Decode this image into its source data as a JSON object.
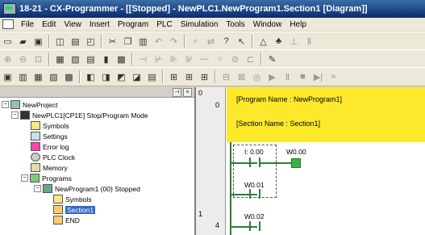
{
  "window": {
    "title": "18-21 - CX-Programmer - [[Stopped] - NewPLC1.NewProgram1.Section1 [Diagram]]"
  },
  "menu": [
    "File",
    "Edit",
    "View",
    "Insert",
    "Program",
    "PLC",
    "Simulation",
    "Tools",
    "Window",
    "Help"
  ],
  "toolbars": {
    "row1": [
      "new-icon",
      "open-icon",
      "save-icon",
      "print-preview-icon",
      "print-icon",
      "preview-icon",
      "cut-icon",
      "copy-icon",
      "paste-icon",
      "undo-icon",
      "redo-icon",
      "find-icon",
      "replace-icon",
      "help-icon",
      "context-help-icon",
      "zoom-icon",
      "monitor-icon",
      "online-icon",
      "clock-icon"
    ],
    "row2": [
      "zoom-in-icon",
      "zoom-out-icon",
      "zoom-fit-icon",
      "grid-icon",
      "layout-icon",
      "table-icon",
      "bookmark-icon",
      "properties-icon",
      "contact-no-icon",
      "contact-nc-icon",
      "or-no-icon",
      "or-nc-icon",
      "line-icon",
      "coil-icon",
      "coil-nc-icon",
      "instruction-icon",
      "online-edit-icon"
    ],
    "row3": [
      "project-icon",
      "section-icon",
      "symbols-icon",
      "window-icon",
      "io-table-icon",
      "monitor-icon",
      "watch-icon",
      "memory-icon",
      "transfer-icon",
      "ladder-icon",
      "bits-16-icon",
      "bits-32-icon",
      "bits-64-icon",
      "compile-icon",
      "check-icon",
      "simulate-icon",
      "run-icon",
      "pause-icon",
      "stop-icon",
      "step-icon",
      "step-into-icon"
    ]
  },
  "tree": {
    "project": "NewProject",
    "plc": "NewPLC1[CP1E] Stop/Program Mode",
    "plc_items": [
      "Symbols",
      "Settings",
      "Error log",
      "PLC Clock",
      "Memory"
    ],
    "programs": "Programs",
    "program": "NewProgram1 (00) Stopped",
    "program_items": [
      "Symbols",
      "Section1",
      "END"
    ]
  },
  "diagram": {
    "program_name": "[Program Name : NewProgram1]",
    "section_name": "[Section Name : Section1]",
    "rung0": {
      "number": "0",
      "step": "0",
      "contact1": "I: 0.00",
      "contact2": "W0.00",
      "coil": "W0.01"
    },
    "rung1": {
      "number": "1",
      "step": "4",
      "contact1": "W0.02"
    },
    "header_rung": "0"
  },
  "colors": {
    "comment_bg": "#fde82c",
    "ladder": "#2e7d32",
    "selection": "#316ac5"
  }
}
